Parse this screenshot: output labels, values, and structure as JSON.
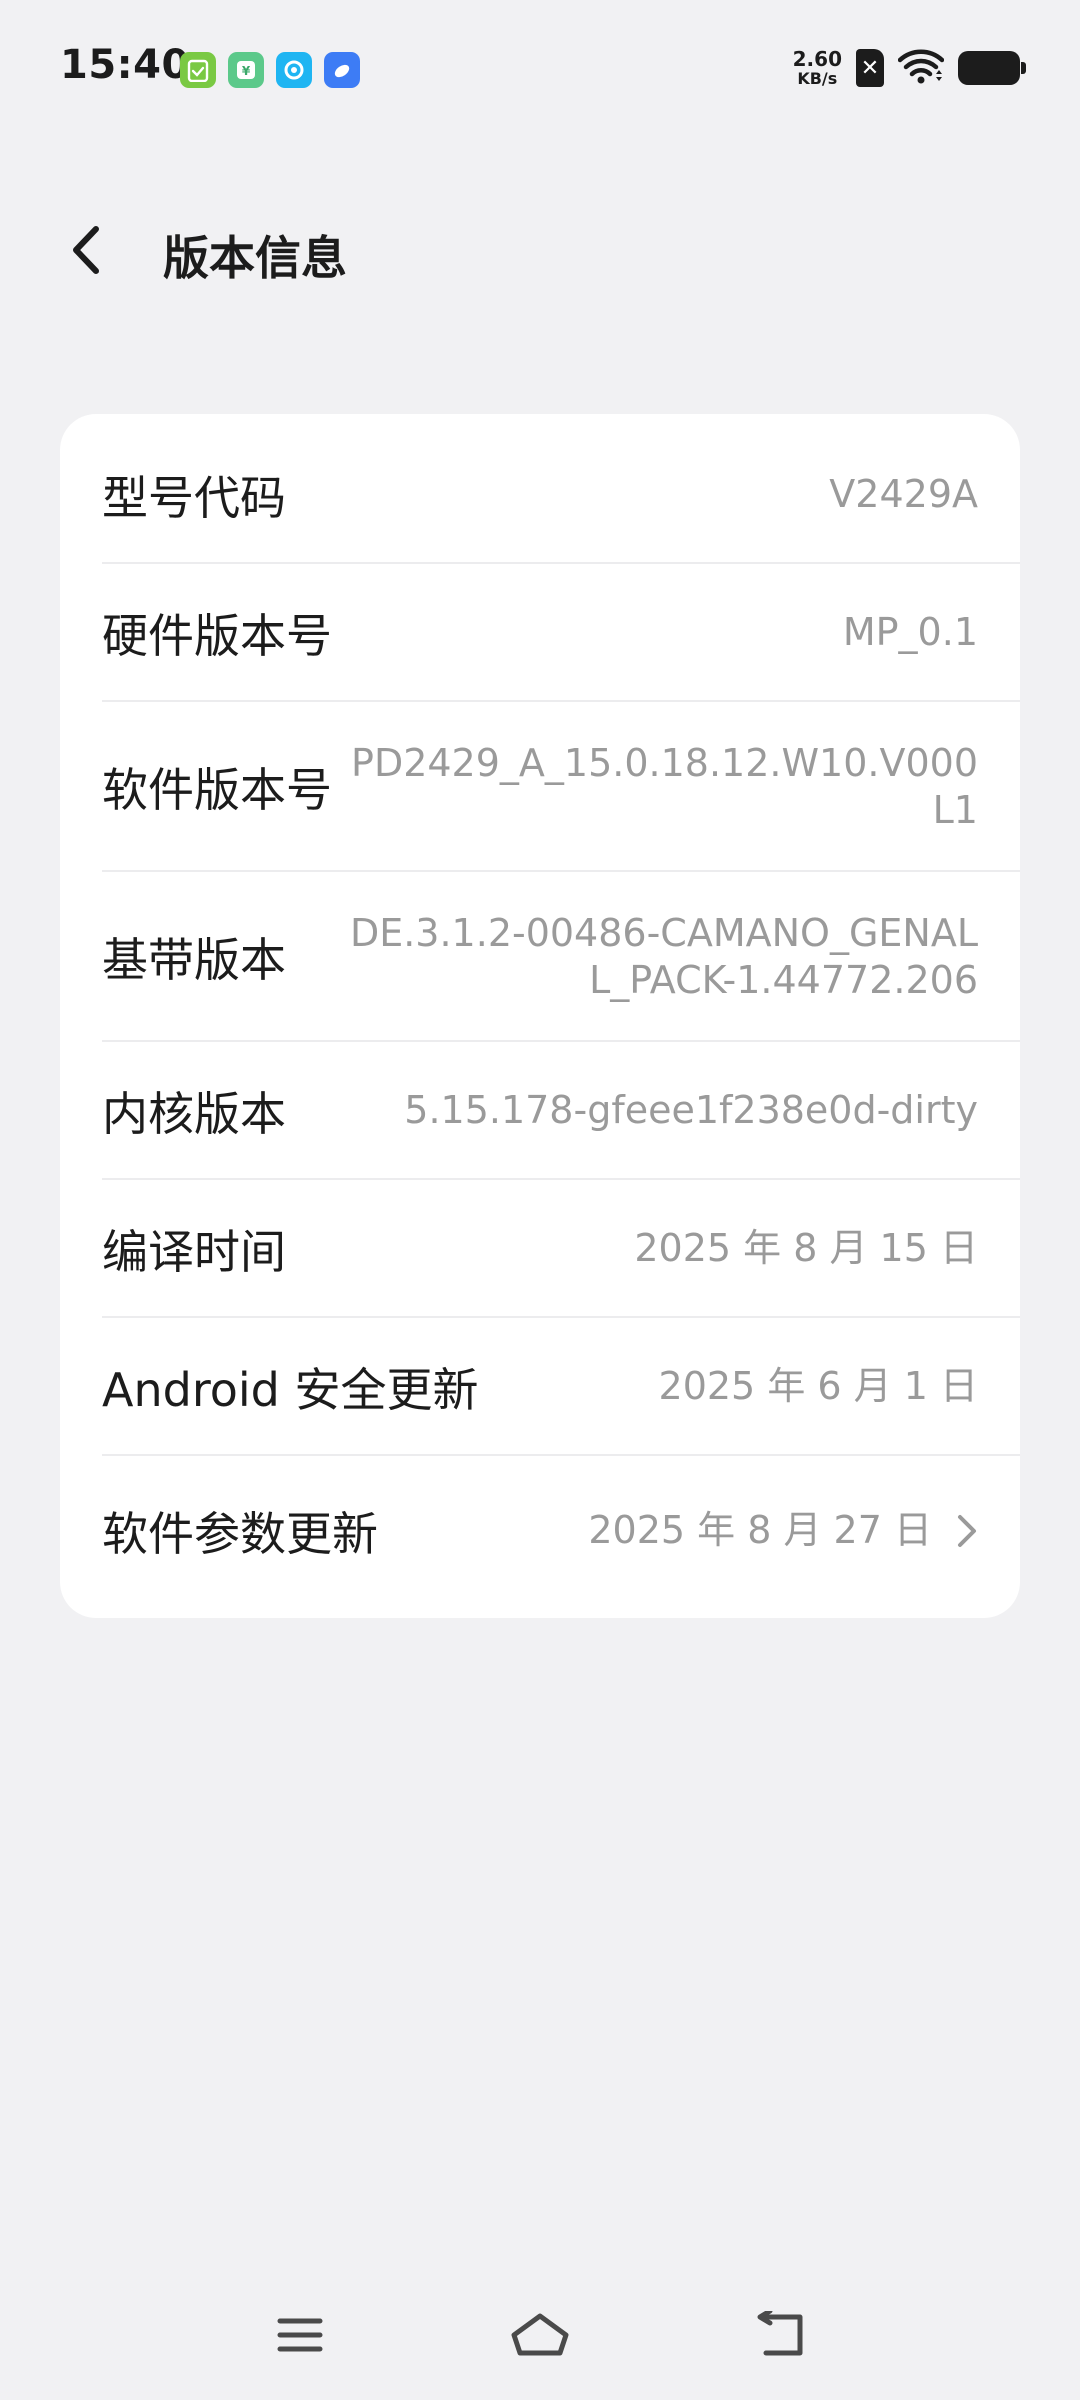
{
  "status_bar": {
    "time": "15:40",
    "net_speed_value": "2.60",
    "net_speed_unit": "KB/s",
    "notification_icons": [
      "clipboard-check-app-icon",
      "wallet-app-icon",
      "browser-app-icon",
      "cloud-app-icon"
    ],
    "sim_glyph": "✕"
  },
  "header": {
    "title": "版本信息"
  },
  "info_rows": [
    {
      "label": "型号代码",
      "value": "V2429A"
    },
    {
      "label": "硬件版本号",
      "value": "MP_0.1"
    },
    {
      "label": "软件版本号",
      "value": "PD2429_A_15.0.18.12.W10.V000\nL1"
    },
    {
      "label": "基带版本",
      "value": "DE.3.1.2-00486-CAMANO_GENAL\nL_PACK-1.44772.206"
    },
    {
      "label": "内核版本",
      "value": "5.15.178-gfeee1f238e0d-dirty"
    },
    {
      "label": "编译时间",
      "value": "2025 年 8 月 15 日"
    },
    {
      "label": "Android 安全更新",
      "value": "2025 年 6 月 1 日"
    },
    {
      "label": "软件参数更新",
      "value": "2025 年 8 月 27 日"
    }
  ],
  "colors": {
    "background": "#f1f1f3",
    "card": "#ffffff",
    "label_text": "#1c1c1c",
    "value_text": "#9a9a9a",
    "divider": "#ececee"
  },
  "nav_bar": {
    "icons": [
      "menu-icon",
      "home-icon",
      "back-icon"
    ]
  }
}
